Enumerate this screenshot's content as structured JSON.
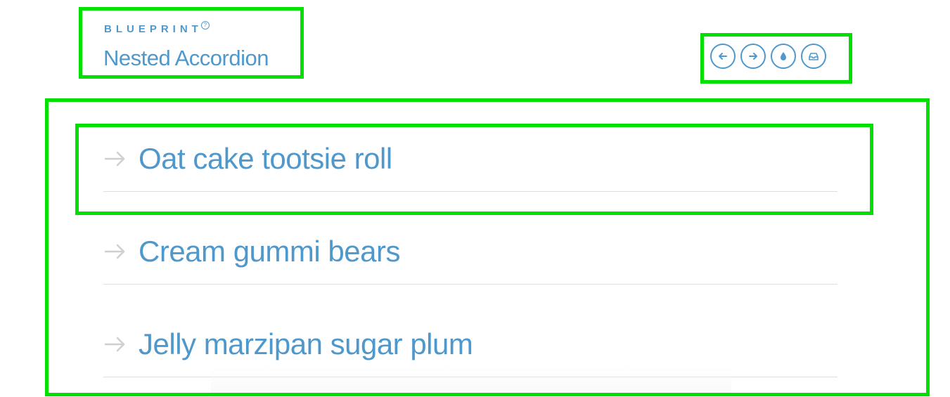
{
  "header": {
    "brand": "BLUEPRINT",
    "help_icon": "question-circle-icon",
    "title": "Nested Accordion"
  },
  "nav": {
    "buttons": [
      {
        "icon": "arrow-left-circle-icon"
      },
      {
        "icon": "arrow-right-circle-icon"
      },
      {
        "icon": "drop-icon"
      },
      {
        "icon": "inbox-icon"
      }
    ]
  },
  "accordion": {
    "items": [
      {
        "label": "Oat cake tootsie roll",
        "icon": "arrow-right-icon"
      },
      {
        "label": "Cream gummi bears",
        "icon": "arrow-right-icon"
      },
      {
        "label": "Jelly marzipan sugar plum",
        "icon": "arrow-right-icon"
      }
    ]
  },
  "colors": {
    "accent": "#4f98cc",
    "arrow": "#cfcfcf",
    "divider": "#dedede",
    "annotation": "#00e000"
  }
}
